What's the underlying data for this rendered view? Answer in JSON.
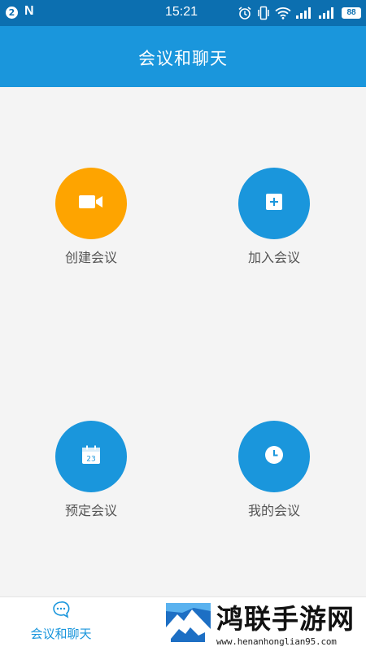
{
  "status_bar": {
    "notification_count": "2",
    "app_letter": "N",
    "time": "15:21",
    "battery": "88",
    "icons": [
      "alarm-icon",
      "vibrate-icon",
      "wifi-icon",
      "signal-icon",
      "signal-icon",
      "battery-icon"
    ]
  },
  "appbar": {
    "title": "会议和聊天"
  },
  "actions": [
    {
      "label": "创建会议",
      "icon": "video-camera-icon",
      "color": "#fea400"
    },
    {
      "label": "加入会议",
      "icon": "plus-square-icon",
      "color": "#1a96dc"
    },
    {
      "label": "预定会议",
      "icon": "calendar-icon",
      "color": "#1a96dc",
      "icon_text": "23"
    },
    {
      "label": "我的会议",
      "icon": "clock-icon",
      "color": "#1a96dc"
    }
  ],
  "bottom_nav": {
    "tabs": [
      {
        "label": "会议和聊天",
        "icon": "chat-bubble-icon",
        "active": true
      }
    ]
  },
  "watermark": {
    "title": "鸿联手游网",
    "url": "www.henanhonglian95.com"
  },
  "colors": {
    "primary": "#1a96dc",
    "accent": "#fea400",
    "status_bar": "#0c6fb0",
    "background": "#f4f4f4"
  }
}
